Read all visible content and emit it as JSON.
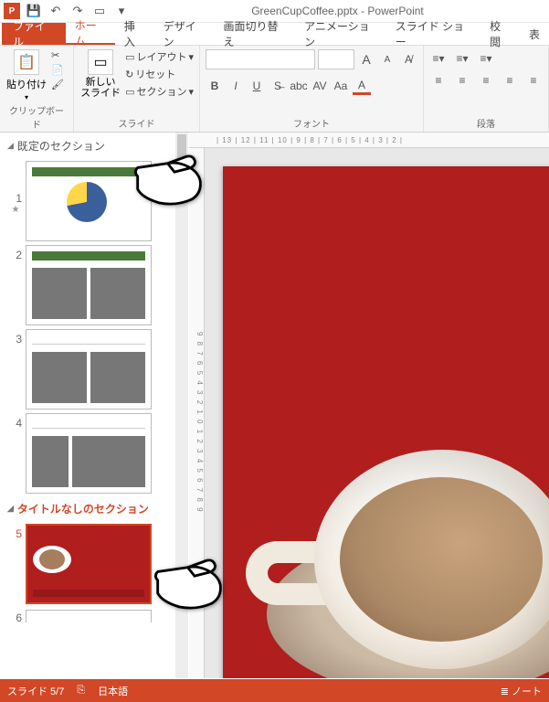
{
  "title": "GreenCupCoffee.pptx - PowerPoint",
  "tabs": {
    "file": "ファイル",
    "home": "ホーム",
    "insert": "挿入",
    "design": "デザイン",
    "transition": "画面切り替え",
    "animation": "アニメーション",
    "slideshow": "スライド ショー",
    "review": "校閲",
    "view": "表"
  },
  "ribbon": {
    "clipboard": {
      "paste": "貼り付け",
      "label": "クリップボード"
    },
    "slides": {
      "new": "新しい\nスライド",
      "layout": "レイアウト",
      "reset": "リセット",
      "section": "セクション",
      "label": "スライド"
    },
    "font": {
      "label": "フォント",
      "size_up": "A",
      "size_down": "A"
    },
    "paragraph": {
      "label": "段落"
    }
  },
  "sections": {
    "default": "既定のセクション",
    "untitled": "タイトルなしのセクション"
  },
  "slide_nums": [
    "1",
    "2",
    "3",
    "4",
    "5",
    "6"
  ],
  "ruler_h": "| 13 | 12 | 11 | 10 | 9 | 8 | 7 | 6 | 5 | 4 | 3 | 2 |",
  "ruler_v": "9 8 7 6 5 4 3 2 1 0 1 2 3 4 5 6 7 8 9",
  "status": {
    "slide": "スライド 5/7",
    "lang": "日本語",
    "notes": "ノート"
  }
}
